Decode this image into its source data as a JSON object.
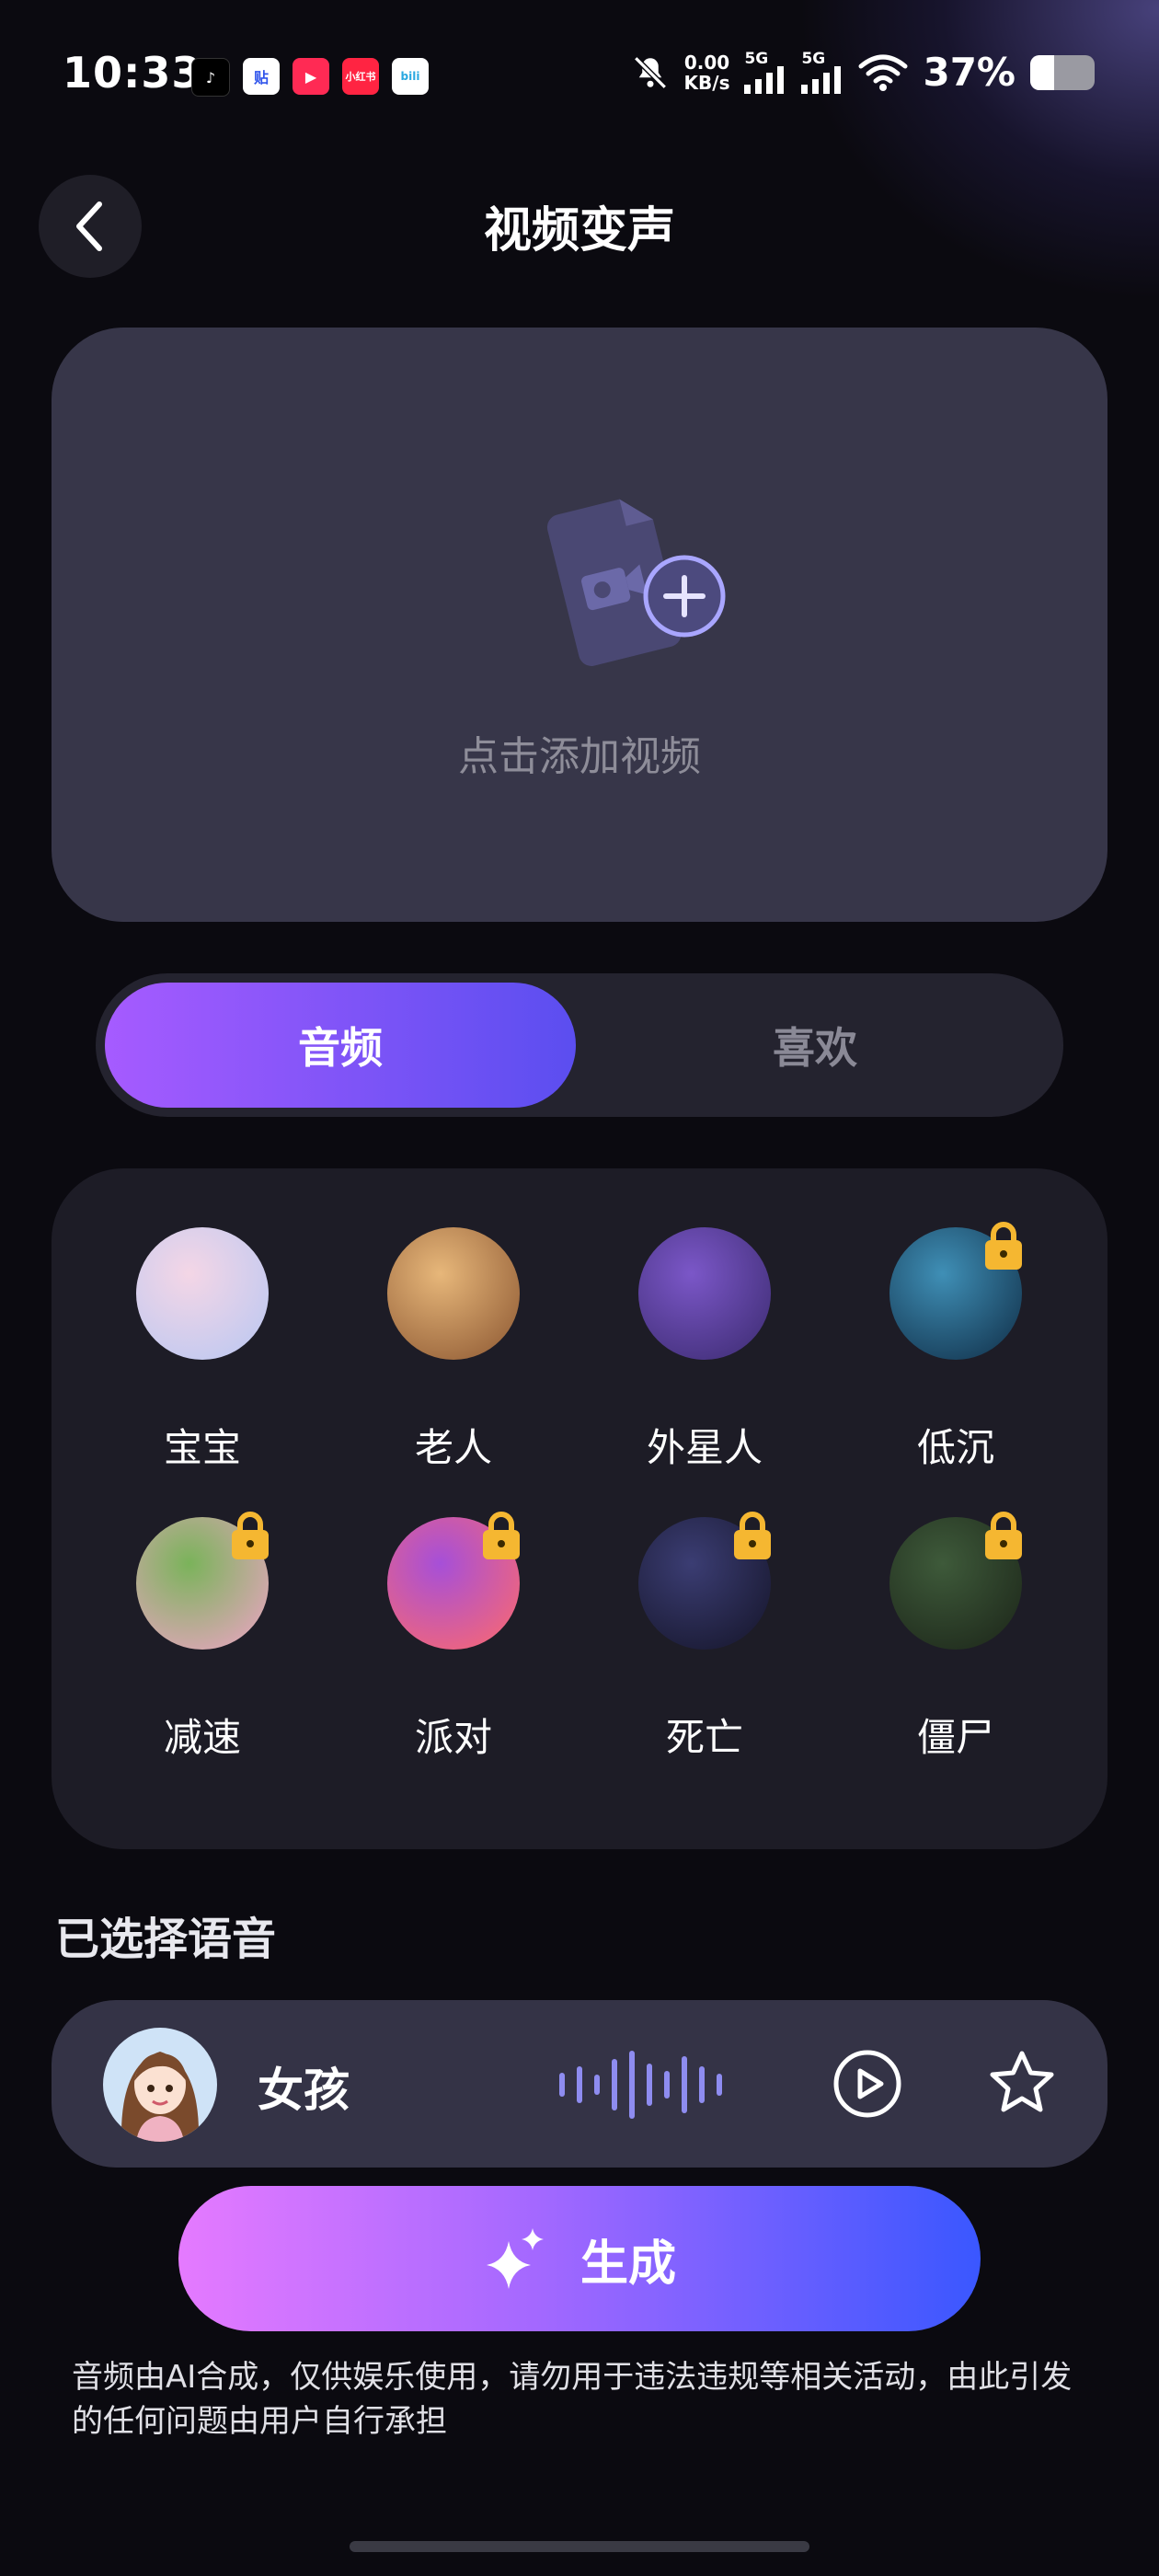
{
  "status_bar": {
    "time": "10:33",
    "apps": [
      {
        "name": "douyin-app-icon",
        "glyph": "♪"
      },
      {
        "name": "tieba-app-icon",
        "glyph": "贴"
      },
      {
        "name": "video-app-icon",
        "glyph": "▶"
      },
      {
        "name": "xiaohongshu-app-icon",
        "glyph": "小红书"
      },
      {
        "name": "bilibili-app-icon",
        "glyph": "bili"
      }
    ],
    "net_speed_value": "0.00",
    "net_speed_unit": "KB/s",
    "signal1_label": "5G",
    "signal2_label": "5G",
    "battery_percent": "37%",
    "battery_level": 0.37
  },
  "header": {
    "title": "视频变声"
  },
  "upload": {
    "label": "点击添加视频"
  },
  "tabs": [
    {
      "label": "音频",
      "active": true
    },
    {
      "label": "喜欢",
      "active": false
    }
  ],
  "voices": [
    {
      "label": "宝宝",
      "locked": false,
      "palette": [
        "#f4d6e6",
        "#b8c7f2"
      ]
    },
    {
      "label": "老人",
      "locked": false,
      "palette": [
        "#e7b77a",
        "#8a5530"
      ]
    },
    {
      "label": "外星人",
      "locked": false,
      "palette": [
        "#7b57c8",
        "#3a2a6e"
      ]
    },
    {
      "label": "低沉",
      "locked": true,
      "palette": [
        "#3f8fb6",
        "#0f2c45"
      ]
    },
    {
      "label": "减速",
      "locked": true,
      "palette": [
        "#7ab35a",
        "#f0a4c8"
      ]
    },
    {
      "label": "派对",
      "locked": true,
      "palette": [
        "#a64fd8",
        "#ff6a6a"
      ]
    },
    {
      "label": "死亡",
      "locked": true,
      "palette": [
        "#3b3d73",
        "#141428"
      ]
    },
    {
      "label": "僵尸",
      "locked": true,
      "palette": [
        "#3e5a3a",
        "#1b2418"
      ]
    }
  ],
  "selected": {
    "heading": "已选择语音",
    "name": "女孩",
    "avatar_palette": [
      "#cfe3f7",
      "#7a4a2c"
    ]
  },
  "generate": {
    "label": "生成"
  },
  "disclaimer": "音频由AI合成，仅供娱乐使用，请勿用于违法违规等相关活动，由此引发的任何问题由用户自行承担",
  "colors": {
    "accent_start": "#a65bff",
    "accent_end": "#5b4ef0",
    "generate_start": "#e57aff",
    "generate_end": "#3a57ff",
    "lock": "#f5b731",
    "waveform": "#8e8cf0"
  }
}
